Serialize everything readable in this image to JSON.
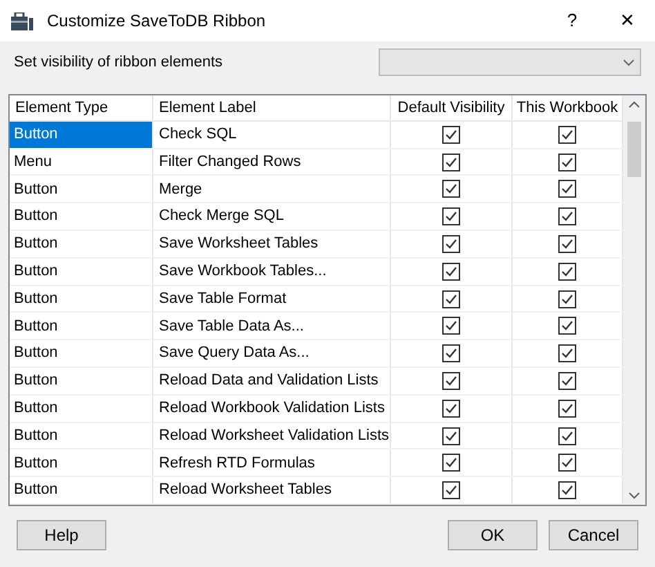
{
  "window": {
    "title": "Customize SaveToDB Ribbon",
    "help": "?",
    "close": "✕"
  },
  "visibility_label": "Set visibility of ribbon elements",
  "table": {
    "columns": [
      "Element Type",
      "Element Label",
      "Default Visibility",
      "This Workbook"
    ],
    "rows": [
      {
        "type": "Button",
        "label": "Check SQL",
        "default_visibility": true,
        "this_workbook": true,
        "selected": true
      },
      {
        "type": "Menu",
        "label": "Filter Changed Rows",
        "default_visibility": true,
        "this_workbook": true,
        "selected": false
      },
      {
        "type": "Button",
        "label": "Merge",
        "default_visibility": true,
        "this_workbook": true,
        "selected": false
      },
      {
        "type": "Button",
        "label": "Check Merge SQL",
        "default_visibility": true,
        "this_workbook": true,
        "selected": false
      },
      {
        "type": "Button",
        "label": "Save Worksheet Tables",
        "default_visibility": true,
        "this_workbook": true,
        "selected": false
      },
      {
        "type": "Button",
        "label": "Save Workbook Tables...",
        "default_visibility": true,
        "this_workbook": true,
        "selected": false
      },
      {
        "type": "Button",
        "label": "Save Table Format",
        "default_visibility": true,
        "this_workbook": true,
        "selected": false
      },
      {
        "type": "Button",
        "label": "Save Table Data As...",
        "default_visibility": true,
        "this_workbook": true,
        "selected": false
      },
      {
        "type": "Button",
        "label": "Save Query Data As...",
        "default_visibility": true,
        "this_workbook": true,
        "selected": false
      },
      {
        "type": "Button",
        "label": "Reload Data and Validation Lists",
        "default_visibility": true,
        "this_workbook": true,
        "selected": false
      },
      {
        "type": "Button",
        "label": "Reload Workbook Validation Lists",
        "default_visibility": true,
        "this_workbook": true,
        "selected": false
      },
      {
        "type": "Button",
        "label": "Reload Worksheet Validation Lists",
        "default_visibility": true,
        "this_workbook": true,
        "selected": false
      },
      {
        "type": "Button",
        "label": "Refresh RTD Formulas",
        "default_visibility": true,
        "this_workbook": true,
        "selected": false
      },
      {
        "type": "Button",
        "label": "Reload Worksheet Tables",
        "default_visibility": true,
        "this_workbook": true,
        "selected": false
      }
    ]
  },
  "left_buttons": [
    "Help"
  ],
  "right_buttons": [
    "OK",
    "Cancel"
  ]
}
